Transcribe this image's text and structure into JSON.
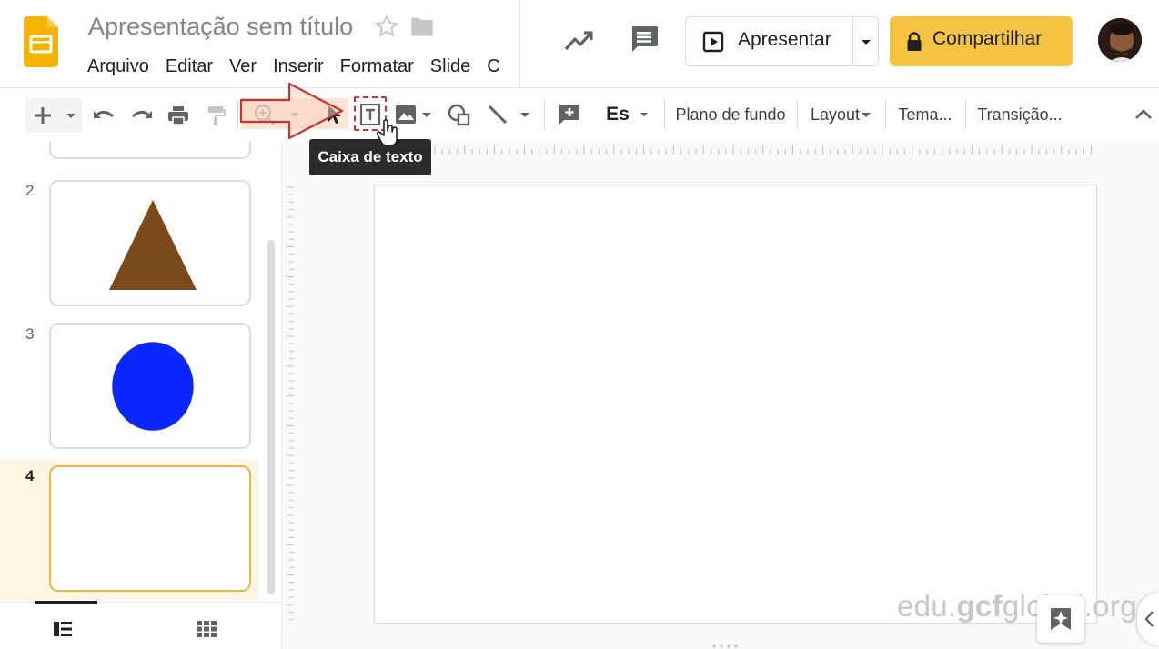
{
  "app": {
    "doc_title": "Apresentação sem título",
    "menu": [
      "Arquivo",
      "Editar",
      "Ver",
      "Inserir",
      "Formatar",
      "Slide",
      "C"
    ]
  },
  "header": {
    "present_label": "Apresentar",
    "share_label": "Compartilhar"
  },
  "toolbar": {
    "text_style_label": "Es",
    "background_label": "Plano de fundo",
    "layout_label": "Layout",
    "theme_label": "Tema...",
    "transition_label": "Transição..."
  },
  "tooltip": {
    "text": "Caixa de texto"
  },
  "filmstrip": {
    "slides": [
      {
        "number": "2",
        "content": "triangle",
        "color": "#7b4a1b"
      },
      {
        "number": "3",
        "content": "circle",
        "color": "#0a26ff"
      },
      {
        "number": "4",
        "content": "empty",
        "selected": true
      }
    ]
  },
  "watermark": {
    "prefix": "edu.",
    "brand": "gcf",
    "suffix": "global.org"
  },
  "colors": {
    "share_button": "#f6c343",
    "selected_slide_border": "#e6b94a",
    "annotation": "#c0392b"
  },
  "icons": [
    "slides-logo-icon",
    "star-icon",
    "folder-icon",
    "activity-trend-icon",
    "comment-icon",
    "present-icon",
    "lock-icon",
    "new-slide-icon",
    "undo-icon",
    "redo-icon",
    "print-icon",
    "paint-format-icon",
    "zoom-icon",
    "select-cursor-icon",
    "textbox-icon",
    "image-icon",
    "shape-icon",
    "line-icon",
    "add-comment-icon",
    "collapse-icon",
    "list-view-icon",
    "grid-view-icon",
    "explore-icon"
  ]
}
